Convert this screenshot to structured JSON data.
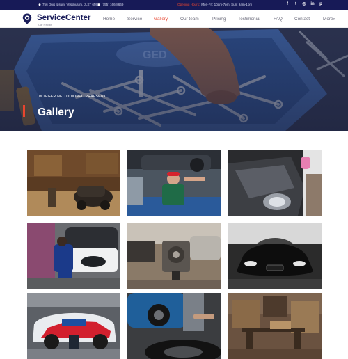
{
  "topbar": {
    "address": "756 Duis Ipsum, Vestibulum, JLST 6M5",
    "phone": "(755) 166-8669",
    "hours_label": "Opening Hours:",
    "hours": "Mon-Fri: 10am-7pm, Sun: 9am-1pm",
    "social": [
      "facebook-icon",
      "twitter-icon",
      "instagram-icon",
      "linkedin-icon",
      "pinterest-icon"
    ],
    "social_glyphs": [
      "f",
      "t",
      "◎",
      "in",
      "p"
    ]
  },
  "nav": {
    "brand": "ServiceCenter",
    "tagline": "Car Repair",
    "links": [
      "Home",
      "Service",
      "Gallery",
      "Our team",
      "Pricing",
      "Testimonial",
      "FAQ",
      "Contact",
      "More"
    ],
    "more_arrow": "▾",
    "active_index": 2
  },
  "hero": {
    "kicker": "INTEGER NEC ODIONEC PRAESENT",
    "title": "Gallery"
  },
  "gallery": {
    "items": [
      "garage-vintage-car-photo",
      "mechanic-under-lift-photo",
      "car-washing-photo",
      "mechanic-engine-bay-photo",
      "engine-on-stand-photo",
      "black-sports-car-photo",
      "rally-car-photo",
      "tire-change-photo",
      "workshop-shelves-photo"
    ]
  },
  "colors": {
    "topbar_bg": "#171a57",
    "brand": "#1a1d5a",
    "accent": "#e8452f",
    "nav_text": "#6b6b7b"
  }
}
